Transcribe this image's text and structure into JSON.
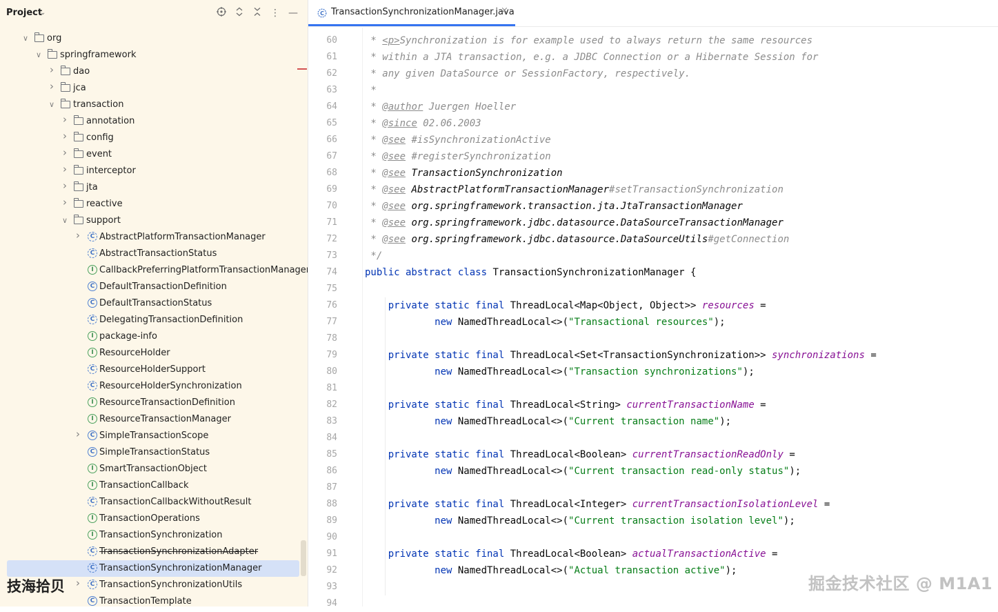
{
  "project_panel": {
    "title": "Project",
    "tree": [
      {
        "label": "org",
        "depth": 0,
        "kind": "folder",
        "expanded": true
      },
      {
        "label": "springframework",
        "depth": 1,
        "kind": "folder",
        "expanded": true
      },
      {
        "label": "dao",
        "depth": 2,
        "kind": "folder",
        "expanded": false
      },
      {
        "label": "jca",
        "depth": 2,
        "kind": "folder",
        "expanded": false
      },
      {
        "label": "transaction",
        "depth": 2,
        "kind": "folder",
        "expanded": true
      },
      {
        "label": "annotation",
        "depth": 3,
        "kind": "folder",
        "expanded": false
      },
      {
        "label": "config",
        "depth": 3,
        "kind": "folder",
        "expanded": false
      },
      {
        "label": "event",
        "depth": 3,
        "kind": "folder",
        "expanded": false
      },
      {
        "label": "interceptor",
        "depth": 3,
        "kind": "folder",
        "expanded": false
      },
      {
        "label": "jta",
        "depth": 3,
        "kind": "folder",
        "expanded": false
      },
      {
        "label": "reactive",
        "depth": 3,
        "kind": "folder",
        "expanded": false
      },
      {
        "label": "support",
        "depth": 3,
        "kind": "folder",
        "expanded": true
      },
      {
        "label": "AbstractPlatformTransactionManager",
        "depth": 4,
        "kind": "abstract-class",
        "expandable": true
      },
      {
        "label": "AbstractTransactionStatus",
        "depth": 4,
        "kind": "abstract-class"
      },
      {
        "label": "CallbackPreferringPlatformTransactionManager",
        "depth": 4,
        "kind": "interface"
      },
      {
        "label": "DefaultTransactionDefinition",
        "depth": 4,
        "kind": "class"
      },
      {
        "label": "DefaultTransactionStatus",
        "depth": 4,
        "kind": "class"
      },
      {
        "label": "DelegatingTransactionDefinition",
        "depth": 4,
        "kind": "abstract-class"
      },
      {
        "label": "package-info",
        "depth": 4,
        "kind": "interface"
      },
      {
        "label": "ResourceHolder",
        "depth": 4,
        "kind": "interface"
      },
      {
        "label": "ResourceHolderSupport",
        "depth": 4,
        "kind": "abstract-class"
      },
      {
        "label": "ResourceHolderSynchronization",
        "depth": 4,
        "kind": "abstract-class"
      },
      {
        "label": "ResourceTransactionDefinition",
        "depth": 4,
        "kind": "interface"
      },
      {
        "label": "ResourceTransactionManager",
        "depth": 4,
        "kind": "interface"
      },
      {
        "label": "SimpleTransactionScope",
        "depth": 4,
        "kind": "class",
        "expandable": true
      },
      {
        "label": "SimpleTransactionStatus",
        "depth": 4,
        "kind": "class"
      },
      {
        "label": "SmartTransactionObject",
        "depth": 4,
        "kind": "interface"
      },
      {
        "label": "TransactionCallback",
        "depth": 4,
        "kind": "interface"
      },
      {
        "label": "TransactionCallbackWithoutResult",
        "depth": 4,
        "kind": "abstract-class"
      },
      {
        "label": "TransactionOperations",
        "depth": 4,
        "kind": "interface"
      },
      {
        "label": "TransactionSynchronization",
        "depth": 4,
        "kind": "interface"
      },
      {
        "label": "TransactionSynchronizationAdapter",
        "depth": 4,
        "kind": "abstract-class",
        "deprecated": true
      },
      {
        "label": "TransactionSynchronizationManager",
        "depth": 4,
        "kind": "abstract-class",
        "selected": true
      },
      {
        "label": "TransactionSynchronizationUtils",
        "depth": 4,
        "kind": "abstract-class",
        "expandable": true
      },
      {
        "label": "TransactionTemplate",
        "depth": 4,
        "kind": "class"
      }
    ]
  },
  "editor": {
    "tab_label": "TransactionSynchronizationManager.java",
    "first_line_number": 60,
    "lines": [
      [
        [
          "cm",
          " * "
        ],
        [
          "tag",
          "<p>"
        ],
        [
          "cm",
          "Synchronization is for example used to always return the same resources"
        ]
      ],
      [
        [
          "cm",
          " * within a JTA transaction, e.g. a JDBC Connection or a Hibernate Session for"
        ]
      ],
      [
        [
          "cm",
          " * any given DataSource or SessionFactory, respectively."
        ]
      ],
      [
        [
          "cm",
          " *"
        ]
      ],
      [
        [
          "cm",
          " * "
        ],
        [
          "tag",
          "@author"
        ],
        [
          "cm",
          " Juergen Hoeller"
        ]
      ],
      [
        [
          "cm",
          " * "
        ],
        [
          "tag",
          "@since"
        ],
        [
          "cm",
          " 02.06.2003"
        ]
      ],
      [
        [
          "cm",
          " * "
        ],
        [
          "tag",
          "@see"
        ],
        [
          "cm",
          " #isSynchronizationActive"
        ]
      ],
      [
        [
          "cm",
          " * "
        ],
        [
          "tag",
          "@see"
        ],
        [
          "cm",
          " #registerSynchronization"
        ]
      ],
      [
        [
          "cm",
          " * "
        ],
        [
          "tag",
          "@see"
        ],
        [
          "ref",
          " TransactionSynchronization"
        ]
      ],
      [
        [
          "cm",
          " * "
        ],
        [
          "tag",
          "@see"
        ],
        [
          "ref",
          " AbstractPlatformTransactionManager"
        ],
        [
          "cm",
          "#setTransactionSynchronization"
        ]
      ],
      [
        [
          "cm",
          " * "
        ],
        [
          "tag",
          "@see"
        ],
        [
          "ref",
          " org.springframework.transaction.jta.JtaTransactionManager"
        ]
      ],
      [
        [
          "cm",
          " * "
        ],
        [
          "tag",
          "@see"
        ],
        [
          "ref",
          " org.springframework.jdbc.datasource.DataSourceTransactionManager"
        ]
      ],
      [
        [
          "cm",
          " * "
        ],
        [
          "tag",
          "@see"
        ],
        [
          "ref",
          " org.springframework.jdbc.datasource.DataSourceUtils"
        ],
        [
          "cm",
          "#getConnection"
        ]
      ],
      [
        [
          "cm",
          " */"
        ]
      ],
      [
        [
          "kw",
          "public abstract class "
        ],
        [
          "pl",
          "TransactionSynchronizationManager {"
        ]
      ],
      [],
      [
        [
          "pl",
          "    "
        ],
        [
          "kw",
          "private static final "
        ],
        [
          "pl",
          "ThreadLocal<Map<Object, Object>> "
        ],
        [
          "fld",
          "resources"
        ],
        [
          "pl",
          " ="
        ]
      ],
      [
        [
          "pl",
          "            "
        ],
        [
          "kw",
          "new "
        ],
        [
          "pl",
          "NamedThreadLocal<>("
        ],
        [
          "str",
          "\"Transactional resources\""
        ],
        [
          "pl",
          ");"
        ]
      ],
      [],
      [
        [
          "pl",
          "    "
        ],
        [
          "kw",
          "private static final "
        ],
        [
          "pl",
          "ThreadLocal<Set<TransactionSynchronization>> "
        ],
        [
          "fld",
          "synchronizations"
        ],
        [
          "pl",
          " ="
        ]
      ],
      [
        [
          "pl",
          "            "
        ],
        [
          "kw",
          "new "
        ],
        [
          "pl",
          "NamedThreadLocal<>("
        ],
        [
          "str",
          "\"Transaction synchronizations\""
        ],
        [
          "pl",
          ");"
        ]
      ],
      [],
      [
        [
          "pl",
          "    "
        ],
        [
          "kw",
          "private static final "
        ],
        [
          "pl",
          "ThreadLocal<String> "
        ],
        [
          "fld",
          "currentTransactionName"
        ],
        [
          "pl",
          " ="
        ]
      ],
      [
        [
          "pl",
          "            "
        ],
        [
          "kw",
          "new "
        ],
        [
          "pl",
          "NamedThreadLocal<>("
        ],
        [
          "str",
          "\"Current transaction name\""
        ],
        [
          "pl",
          ");"
        ]
      ],
      [],
      [
        [
          "pl",
          "    "
        ],
        [
          "kw",
          "private static final "
        ],
        [
          "pl",
          "ThreadLocal<Boolean> "
        ],
        [
          "fld",
          "currentTransactionReadOnly"
        ],
        [
          "pl",
          " ="
        ]
      ],
      [
        [
          "pl",
          "            "
        ],
        [
          "kw",
          "new "
        ],
        [
          "pl",
          "NamedThreadLocal<>("
        ],
        [
          "str",
          "\"Current transaction read-only status\""
        ],
        [
          "pl",
          ");"
        ]
      ],
      [],
      [
        [
          "pl",
          "    "
        ],
        [
          "kw",
          "private static final "
        ],
        [
          "pl",
          "ThreadLocal<Integer> "
        ],
        [
          "fld",
          "currentTransactionIsolationLevel"
        ],
        [
          "pl",
          " ="
        ]
      ],
      [
        [
          "pl",
          "            "
        ],
        [
          "kw",
          "new "
        ],
        [
          "pl",
          "NamedThreadLocal<>("
        ],
        [
          "str",
          "\"Current transaction isolation level\""
        ],
        [
          "pl",
          ");"
        ]
      ],
      [],
      [
        [
          "pl",
          "    "
        ],
        [
          "kw",
          "private static final "
        ],
        [
          "pl",
          "ThreadLocal<Boolean> "
        ],
        [
          "fld",
          "actualTransactionActive"
        ],
        [
          "pl",
          " ="
        ]
      ],
      [
        [
          "pl",
          "            "
        ],
        [
          "kw",
          "new "
        ],
        [
          "pl",
          "NamedThreadLocal<>("
        ],
        [
          "str",
          "\"Actual transaction active\""
        ],
        [
          "pl",
          ");"
        ]
      ],
      [],
      []
    ]
  },
  "watermarks": {
    "left": "技海拾贝",
    "right": "掘金技术社区 @ M1A1"
  },
  "colors": {
    "accent": "#3574f0",
    "selection": "#d5e1f7",
    "panel_bg": "#fdf7e9"
  }
}
